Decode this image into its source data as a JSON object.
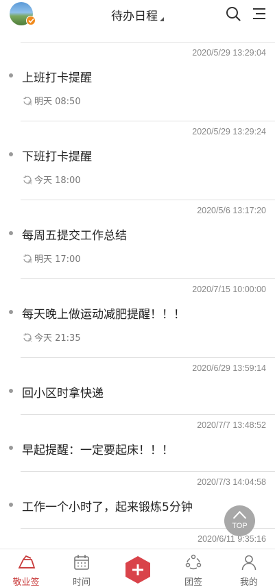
{
  "header": {
    "title": "待办日程",
    "avatar_icon": "landscape-avatar",
    "badge_icon": "check-badge-icon",
    "search_icon": "search-icon",
    "menu_icon": "menu-icon"
  },
  "items": [
    {
      "timestamp": "2020/5/29 13:29:04",
      "title": "上班打卡提醒",
      "remind": "明天 08:50"
    },
    {
      "timestamp": "2020/5/29 13:29:24",
      "title": "下班打卡提醒",
      "remind": "今天 18:00"
    },
    {
      "timestamp": "2020/5/6 13:17:20",
      "title": "每周五提交工作总结",
      "remind": "明天 17:00"
    },
    {
      "timestamp": "2020/7/15 10:00:00",
      "title": "每天晚上做运动减肥提醒！！！",
      "remind": "今天 21:35"
    },
    {
      "timestamp": "2020/6/29 13:59:14",
      "title": "回小区时拿快递"
    },
    {
      "timestamp": "2020/7/7 13:48:52",
      "title": "早起提醒：一定要起床！！！"
    },
    {
      "timestamp": "2020/7/3 14:04:58",
      "title": "工作一个小时了，起来锻炼5分钟"
    },
    {
      "timestamp": "2020/6/11 9:35:16"
    }
  ],
  "top_button": {
    "label": "TOP"
  },
  "nav": {
    "items": [
      {
        "label": "敬业签",
        "icon": "notebook-icon",
        "active": true
      },
      {
        "label": "时间",
        "icon": "calendar-icon"
      },
      {
        "label": "",
        "icon": "add-icon"
      },
      {
        "label": "团签",
        "icon": "group-icon"
      },
      {
        "label": "我的",
        "icon": "person-icon"
      }
    ]
  },
  "colors": {
    "accent": "#c83a3a",
    "add_button": "#d9434a"
  }
}
